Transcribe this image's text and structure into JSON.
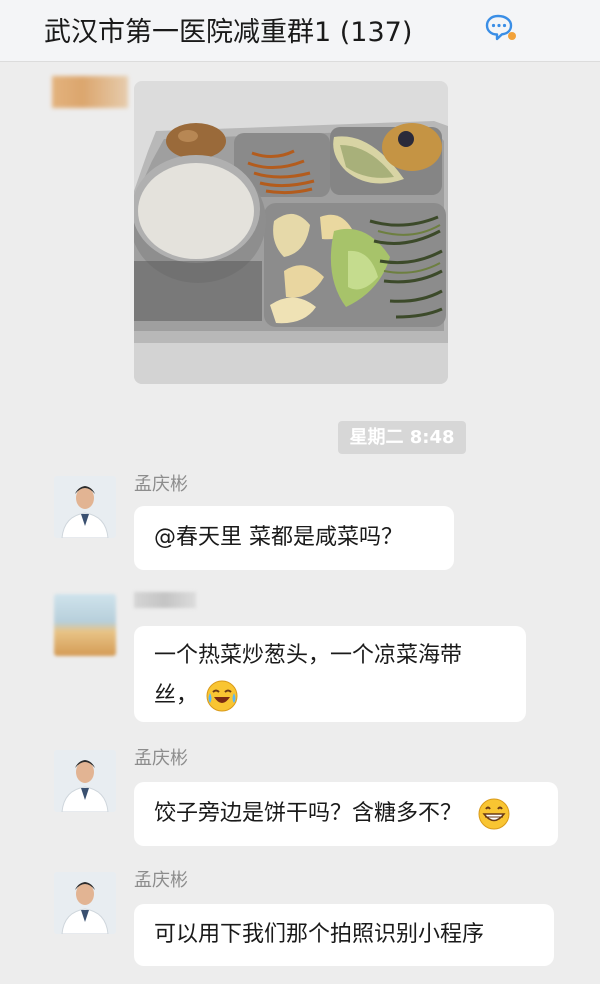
{
  "header": {
    "title": "武汉市第一医院减重群1 (137)"
  },
  "timestamp": "星期二 8:48",
  "messages": [
    {
      "sender": "孟庆彬",
      "text": "@春天里 菜都是咸菜吗？"
    },
    {
      "sender": "",
      "line1": "一个热菜炒葱头，一个凉菜海带",
      "line2": "丝，",
      "emoji": "crying-laughing-emoji"
    },
    {
      "sender": "孟庆彬",
      "text": "饺子旁边是饼干吗？含糖多不？",
      "emoji": "grinning-emoji"
    },
    {
      "sender": "孟庆彬",
      "text": "可以用下我们那个拍照识别小程序"
    }
  ],
  "colors": {
    "background": "#ededed",
    "bubble": "#ffffff",
    "header": "#f4f5f7",
    "name": "#8d8d8d"
  }
}
